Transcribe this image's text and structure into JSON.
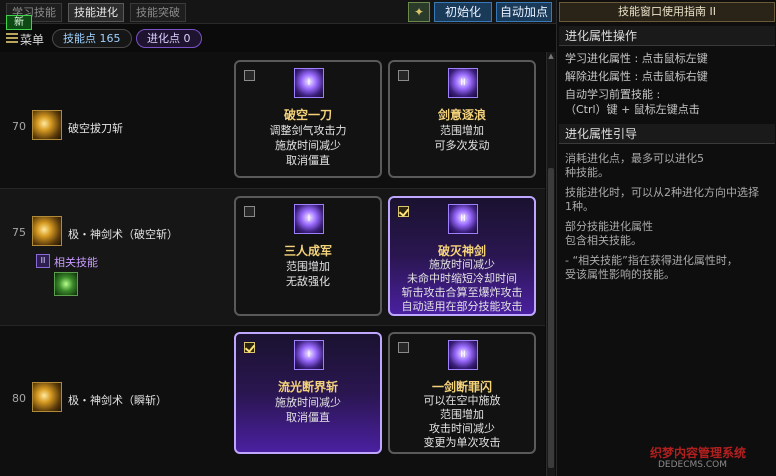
{
  "tabs": [
    {
      "label": "学习技能",
      "active": false
    },
    {
      "label": "技能进化",
      "active": true
    },
    {
      "label": "技能突破",
      "active": false
    }
  ],
  "new_badge": "新",
  "buttons": {
    "init": "初始化",
    "auto": "自动加点"
  },
  "menu_label": "菜单",
  "skill_points": "技能点 165",
  "evo_points": "进化点 0",
  "rows": [
    {
      "level": "70",
      "name": "破空拔刀斩",
      "cards": [
        {
          "checked": false,
          "selected": false,
          "badge": "I",
          "title": "破空一刀",
          "lines": [
            "调整剑气攻击力",
            "施放时间减少",
            "取消僵直"
          ]
        },
        {
          "checked": false,
          "selected": false,
          "badge": "II",
          "title": "剑意逐浪",
          "lines": [
            "范围增加",
            "可多次发动"
          ]
        }
      ]
    },
    {
      "level": "75",
      "name": "极・神剑术（破空斩）",
      "related_label": "相关技能",
      "cards": [
        {
          "checked": false,
          "selected": false,
          "badge": "I",
          "title": "三人成军",
          "lines": [
            "范围增加",
            "无敌强化"
          ]
        },
        {
          "checked": true,
          "selected": true,
          "badge": "II",
          "title": "破灭神剑",
          "lines": [
            "施放时间减少",
            "未命中时缩短冷却时间",
            "斩击攻击合算至爆炸攻击",
            "自动适用在部分技能攻击"
          ]
        }
      ]
    },
    {
      "level": "80",
      "name": "极・神剑术（瞬斩）",
      "cards": [
        {
          "checked": true,
          "selected": true,
          "badge": "I",
          "title": "流光断界斩",
          "lines": [
            "施放时间减少",
            "取消僵直"
          ]
        },
        {
          "checked": false,
          "selected": false,
          "badge": "II",
          "title": "一剑断罪闪",
          "lines": [
            "可以在空中施放",
            "范围增加",
            "攻击时间减少",
            "变更为单次攻击"
          ]
        }
      ]
    }
  ],
  "guide": {
    "title": "技能窗口使用指南 II",
    "section1_title": "进化属性操作",
    "section1_lines": [
      "学习进化属性 : 点击鼠标左键",
      "解除进化属性 : 点击鼠标右键",
      "自动学习前置技能 :",
      "（Ctrl）键 + 鼠标左键点击"
    ],
    "section2_title": "进化属性引导",
    "section2_lines": [
      "消耗进化点，最多可以进化5",
      "种技能。",
      "技能进化时，可以从2种进化方向中选择",
      "1种。",
      "部分技能进化属性",
      "包含相关技能。",
      "- “相关技能”指在获得进化属性时，",
      "受该属性影响的技能。"
    ]
  },
  "watermark": "织梦内容管理系统",
  "watermark_sub": "DEDECMS.COM"
}
